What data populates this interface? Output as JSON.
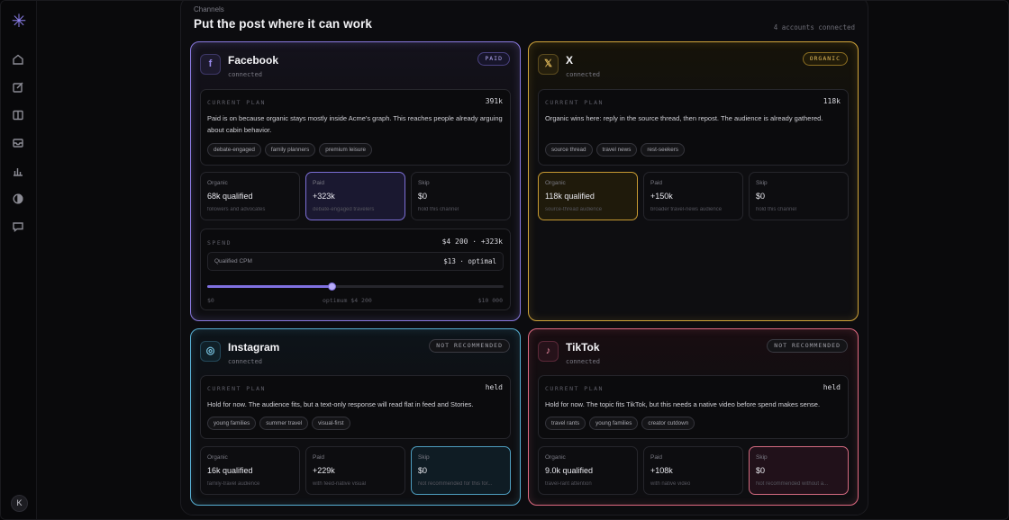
{
  "sidebar": {
    "logo": "✳",
    "items": [
      {
        "icon": "home-icon"
      },
      {
        "icon": "edit-icon"
      },
      {
        "icon": "book-icon"
      },
      {
        "icon": "inbox-icon"
      },
      {
        "icon": "chart-icon"
      },
      {
        "icon": "contrast-icon"
      },
      {
        "icon": "chat-icon"
      }
    ],
    "avatar": "K"
  },
  "header": {
    "eyebrow": "Channels",
    "title": "Put the post where it can work",
    "accounts": "4 accounts connected"
  },
  "channels": {
    "facebook": {
      "name": "Facebook",
      "status": "connected",
      "badge": "PAID",
      "icon_letter": "f",
      "plan_label": "CURRENT PLAN",
      "plan_value": "391k",
      "plan_text": "Paid is on because organic stays mostly inside Acme's graph. This reaches people already arguing about cabin behavior.",
      "tags": [
        "debate-engaged",
        "family planners",
        "premium leisure"
      ],
      "options": [
        {
          "label": "Organic",
          "value": "68k qualified",
          "sub": "followers and advocates"
        },
        {
          "label": "Paid",
          "value": "+323k",
          "sub": "debate-engaged travelers"
        },
        {
          "label": "Skip",
          "value": "$0",
          "sub": "hold this channel"
        }
      ],
      "spend": {
        "label": "SPEND",
        "value": "$4 200 · +323k",
        "cpm_label": "Qualified CPM",
        "cpm_value": "$13 · optimal",
        "slider_fraction": 0.42,
        "min": "$0",
        "mid": "optimum $4 200",
        "max": "$10 000"
      }
    },
    "x": {
      "name": "X",
      "status": "connected",
      "badge": "ORGANIC",
      "icon_letter": "𝕏",
      "plan_label": "CURRENT PLAN",
      "plan_value": "118k",
      "plan_text": "Organic wins here: reply in the source thread, then repost. The audience is already gathered.",
      "tags": [
        "source thread",
        "travel news",
        "rest-seekers"
      ],
      "options": [
        {
          "label": "Organic",
          "value": "118k qualified",
          "sub": "source-thread audience"
        },
        {
          "label": "Paid",
          "value": "+150k",
          "sub": "broader travel-news audience"
        },
        {
          "label": "Skip",
          "value": "$0",
          "sub": "hold this channel"
        }
      ]
    },
    "instagram": {
      "name": "Instagram",
      "status": "connected",
      "badge": "NOT RECOMMENDED",
      "icon_letter": "◎",
      "plan_label": "CURRENT PLAN",
      "plan_value": "held",
      "plan_text": "Hold for now. The audience fits, but a text-only response will read flat in feed and Stories.",
      "tags": [
        "young families",
        "summer travel",
        "visual-first"
      ],
      "options": [
        {
          "label": "Organic",
          "value": "16k qualified",
          "sub": "family-travel audience"
        },
        {
          "label": "Paid",
          "value": "+229k",
          "sub": "with feed-native visual"
        },
        {
          "label": "Skip",
          "value": "$0",
          "sub": "Not recommended for this for..."
        }
      ]
    },
    "tiktok": {
      "name": "TikTok",
      "status": "connected",
      "badge": "NOT RECOMMENDED",
      "icon_letter": "♪",
      "plan_label": "CURRENT PLAN",
      "plan_value": "held",
      "plan_text": "Hold for now. The topic fits TikTok, but this needs a native video before spend makes sense.",
      "tags": [
        "travel rants",
        "young families",
        "creator cutdown"
      ],
      "options": [
        {
          "label": "Organic",
          "value": "9.0k qualified",
          "sub": "travel-rant attention"
        },
        {
          "label": "Paid",
          "value": "+108k",
          "sub": "with native video"
        },
        {
          "label": "Skip",
          "value": "$0",
          "sub": "Not recommended without a..."
        }
      ]
    }
  },
  "colors": {
    "facebook": "#8a7ae0",
    "x": "#d1a53a",
    "instagram": "#58b0d4",
    "tiktok": "#e06a82"
  }
}
